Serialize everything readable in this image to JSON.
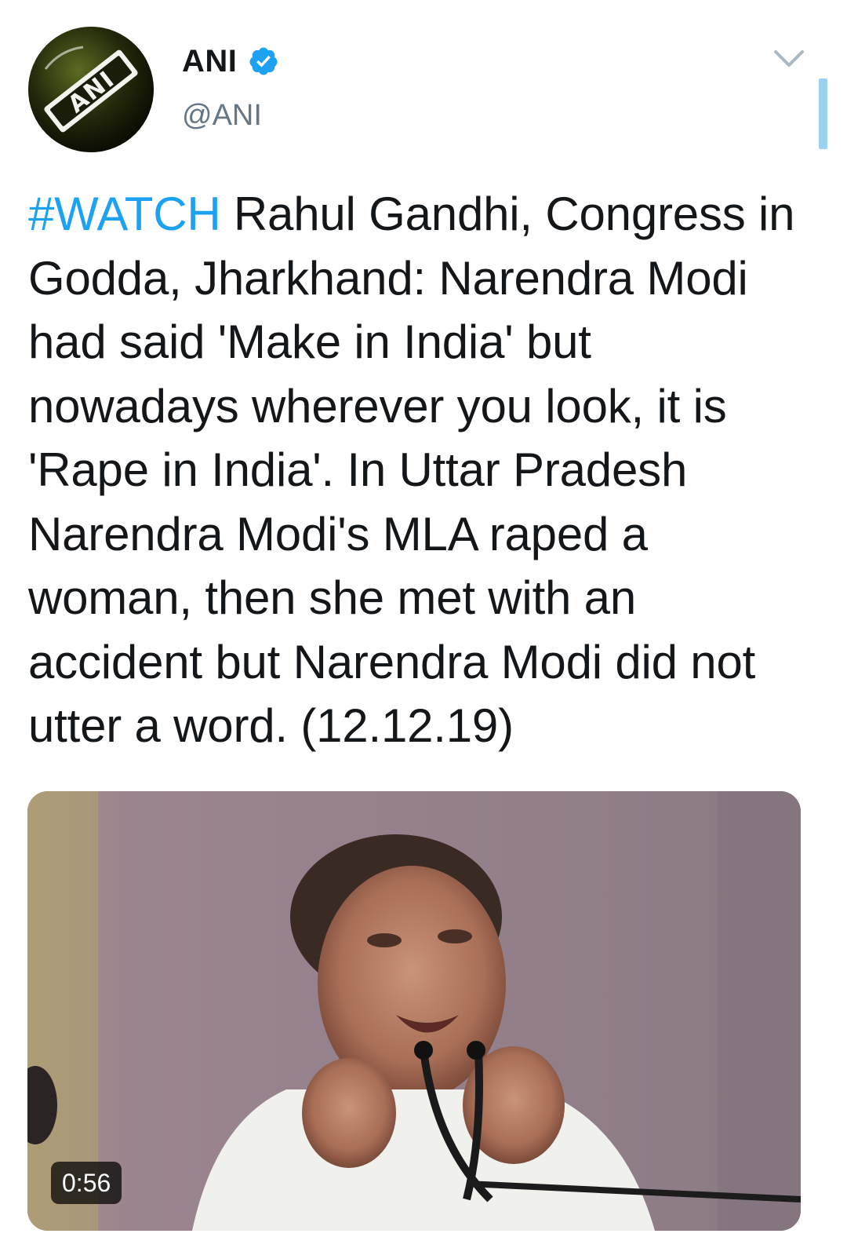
{
  "tweet": {
    "user": {
      "name": "ANI",
      "handle": "@ANI",
      "verified_icon": "verified-badge-icon",
      "avatar_logo_text": "ANI"
    },
    "menu_icon": "chevron-down-icon",
    "text": {
      "hashtag": "#WATCH",
      "body": " Rahul Gandhi, Congress in Godda, Jharkhand: Narendra Modi had said 'Make in India' but nowadays wherever you look, it is 'Rape in India'. In Uttar Pradesh Narendra Modi's MLA raped a woman, then she met with an accident but Narendra Modi did not utter a word. (12.12.19)"
    },
    "media": {
      "type": "video",
      "duration": "0:56"
    }
  },
  "colors": {
    "hashtag": "#1da1f2",
    "verified": "#1da1f2",
    "text": "#14171a",
    "secondary_text": "#657786"
  }
}
